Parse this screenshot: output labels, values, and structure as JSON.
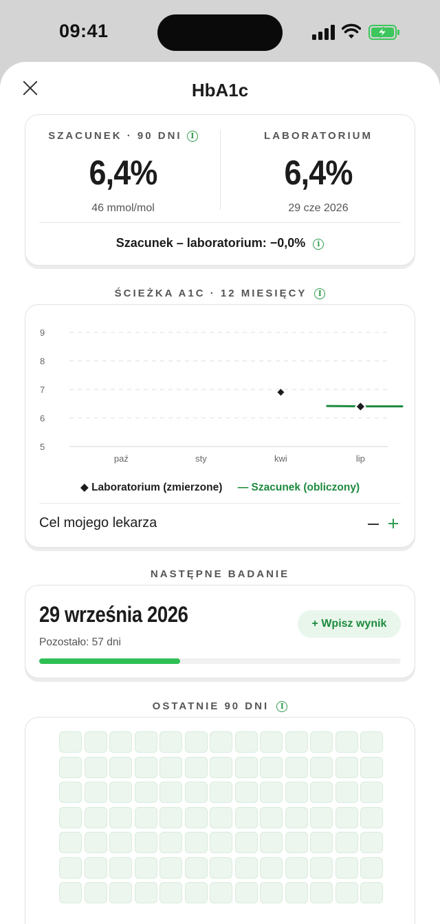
{
  "status_bar": {
    "time": "09:41"
  },
  "header": {
    "title": "HbA1c",
    "close_icon": "close-icon"
  },
  "summary": {
    "estimate": {
      "label": "SZACUNEK · 90 DNI",
      "value": "6,4%",
      "sub": "46 mmol/mol"
    },
    "lab": {
      "label": "LABORATORIUM",
      "value": "6,4%",
      "sub": "29 cze 2026"
    },
    "difference": "Szacunek – laboratorium: −0,0%"
  },
  "trend": {
    "section_title": "ŚCIEŻKA A1C · 12 MIESIĘCY",
    "legend_lab": "◆ Laboratorium (zmierzone)",
    "legend_estimate": "— Szacunek (obliczony)",
    "goal_label": "Cel mojego lekarza"
  },
  "chart_data": {
    "type": "line",
    "ylim": [
      5,
      9
    ],
    "yticks": [
      "9",
      "8",
      "7",
      "6",
      "5"
    ],
    "xticks": [
      "paź",
      "sty",
      "kwi",
      "lip"
    ],
    "grid": true,
    "legend_position": "bottom",
    "series": [
      {
        "name": "Laboratorium (zmierzone)",
        "marker": "diamond",
        "color": "#1c1c1c",
        "points": [
          {
            "x": "kwi",
            "y": 6.9
          },
          {
            "x": "lip",
            "y": 6.4
          }
        ]
      },
      {
        "name": "Szacunek (obliczony)",
        "marker": "line",
        "color": "#1d8a3e",
        "points": [
          {
            "x": "cze",
            "y": 6.42
          },
          {
            "x": "lip",
            "y": 6.42
          },
          {
            "x": "sie",
            "y": 6.42
          }
        ]
      }
    ]
  },
  "next_exam": {
    "section_title": "NASTĘPNE BADANIE",
    "date": "29 września 2026",
    "remaining": "Pozostało: 57 dni",
    "button_label": "+ Wpisz wynik",
    "progress": 0.39
  },
  "recent": {
    "section_title": "OSTATNIE 90 DNI"
  },
  "colors": {
    "accent": "#2e9b4e",
    "progress": "#2fbf55",
    "estimate_line": "#1d8a3e"
  }
}
